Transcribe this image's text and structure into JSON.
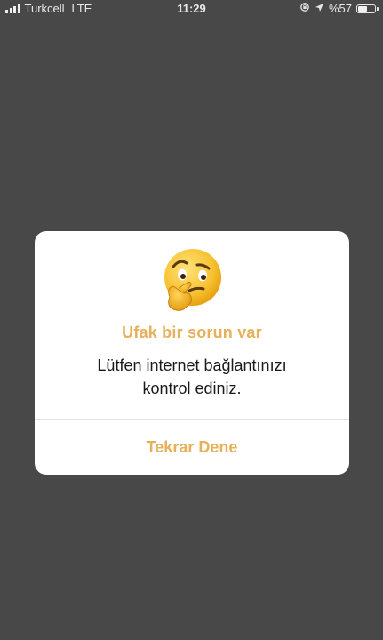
{
  "status_bar": {
    "carrier": "Turkcell",
    "network": "LTE",
    "time": "11:29",
    "battery_text": "%57",
    "battery_level": 0.57
  },
  "dialog": {
    "icon": "thinking-face-emoji",
    "title": "Ufak bir sorun var",
    "message_line1": "Lütfen internet bağlantınızı",
    "message_line2": "kontrol ediniz.",
    "retry_label": "Tekrar Dene"
  },
  "colors": {
    "backdrop": "#484848",
    "accent": "#e6b15a",
    "dialog_bg": "#ffffff",
    "text": "#1a1a1a"
  }
}
